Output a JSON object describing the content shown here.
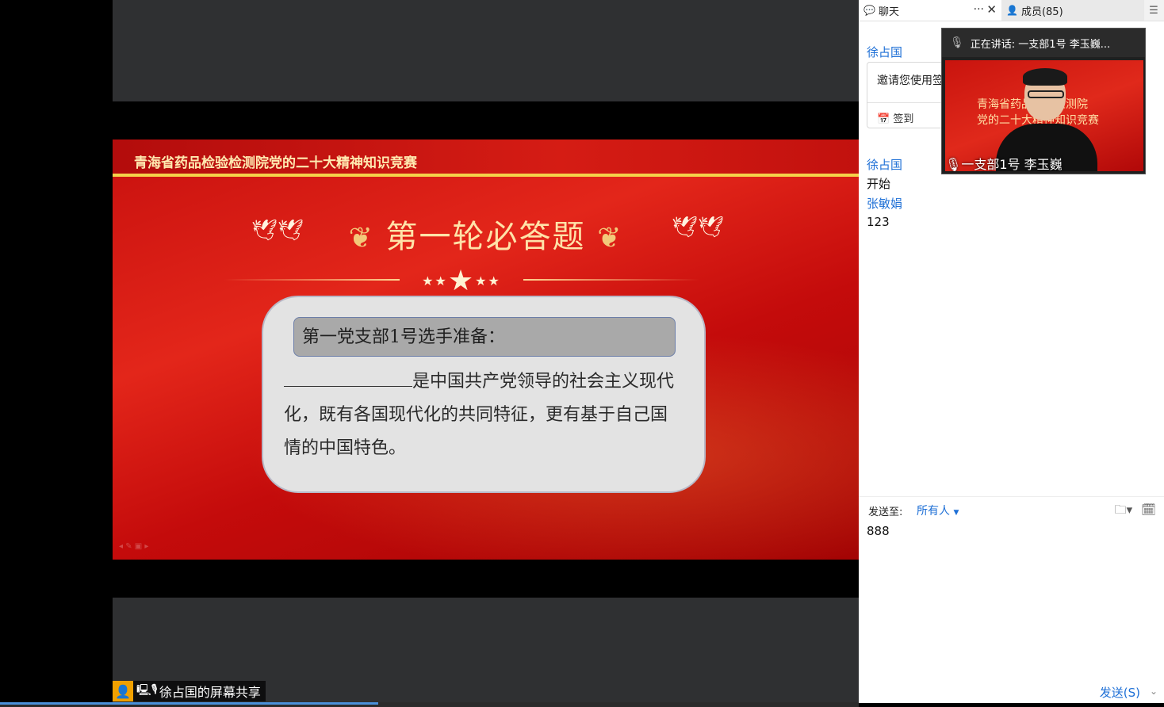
{
  "share": {
    "slide_header": "青海省药品检验检测院党的二十大精神知识竞赛",
    "round_title": "第一轮必答题",
    "contestant": "第一党支部1号选手准备：",
    "question_text": "是中国共产党领导的社会主义现代化，既有各国现代化的共同特征，更有基于自己国情的中国特色。",
    "share_label": "徐占国的屏幕共享",
    "progress": 0.44
  },
  "chat": {
    "tab_chat": "聊天",
    "tab_members": "成员(85)",
    "messages": [
      {
        "name": "徐占国",
        "invite_text": "邀请您使用签",
        "signin": "签到"
      },
      {
        "name": "徐占国",
        "text": "开始"
      },
      {
        "name": "张敏娟",
        "text": "123"
      }
    ],
    "send_to_label": "发送至:",
    "send_to_value": "所有人",
    "input_value": "888",
    "send_button": "发送(S)"
  },
  "video": {
    "speaker": "正在讲话: 一支部1号 李玉巍...",
    "name": "一支部1号 李玉巍",
    "feed_text_1": "青海省药品检验检测院",
    "feed_text_2": "党的二十大精神知识竞赛"
  },
  "colors": {
    "accent": "#1d6fd6",
    "slide_red": "#d51c14",
    "gold": "#f5d24a"
  }
}
